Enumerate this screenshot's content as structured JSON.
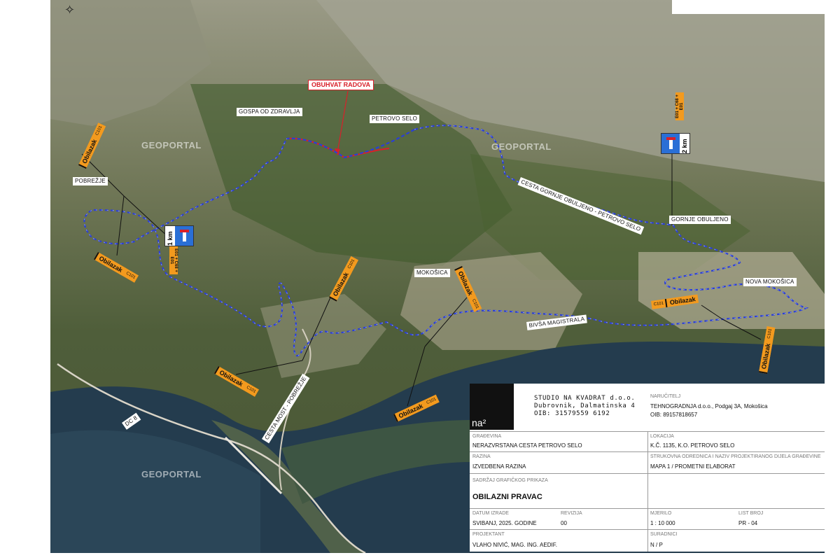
{
  "map": {
    "watermark": "GEOPORTAL",
    "work_area_label": "OBUHVAT RADOVA",
    "places": {
      "gospa": "GOSPA OD ZDRAVLJA",
      "petrovo_selo": "PETROVO SELO",
      "pobrezje": "POBREŽJE",
      "gornje_obuljeno": "GORNJE OBULJENO",
      "mokosica": "MOKOŠICA",
      "nova_mokosica": "NOVA MOKOŠICA",
      "road_gornje": "CESTA GORNJE OBULJENO - PETROVO SELO",
      "road_bivsa": "BIVŠA MAGISTRALA",
      "road_most": "CESTA MOST - POBREŽJE",
      "dc8": "DC 8"
    },
    "detour_sign": "Obilazak",
    "detour_code": "C101",
    "deadend_1": {
      "km": "1 km",
      "codes": "E01 + C68 + E01"
    },
    "deadend_2": {
      "km": "2 km",
      "codes": "E01 + C68 + E01"
    },
    "colors": {
      "detour_route": "#2a3fd6",
      "work_area": "#d8202a",
      "sign": "#f39a1e"
    }
  },
  "title_block": {
    "studio_name": "STUDIO NA KVADRAT d.o.o.",
    "studio_address": "Dubrovnik, Dalmatinska 4",
    "studio_oib": "OIB: 31579559 6192",
    "logo": "na²",
    "investor_caption": "NARUČITELJ",
    "investor": "TEHNOGRADNJA d.o.o., Podgaj 3A, Mokošica",
    "investor_oib": "OIB: 89157818657",
    "building_caption": "GRAĐEVINA",
    "building": "NERAZVRSTANA CESTA PETROVO SELO",
    "location_caption": "LOKACIJA",
    "location": "K.Č. 1135, K.O. PETROVO SELO",
    "level_caption": "RAZINA",
    "level": "IZVEDBENA RAZINA",
    "discipline_caption": "STRUKOVNA ODREDNICA I NAZIV PROJEKTIRANOG DIJELA GRAĐEVINE",
    "discipline": "MAPA 1 / PROMETNI ELABORAT",
    "content_caption": "SADRŽAJ GRAFIČKOG PRIKAZA",
    "content": "OBILAZNI PRAVAC",
    "date_caption": "DATUM IZRADE",
    "date": "SVIBANJ, 2025. GODINE",
    "revision_caption": "REVIZIJA",
    "revision": "00",
    "scale_caption": "MJERILO",
    "scale": "1 : 10 000",
    "sheet_caption": "LIST BROJ",
    "sheet": "PR - 04",
    "designer_caption": "PROJEKTANT",
    "designer": "VLAHO NIVIĆ, MAG. ING. AEDIF.",
    "associates_caption": "SURADNICI",
    "associates": "N / P"
  }
}
